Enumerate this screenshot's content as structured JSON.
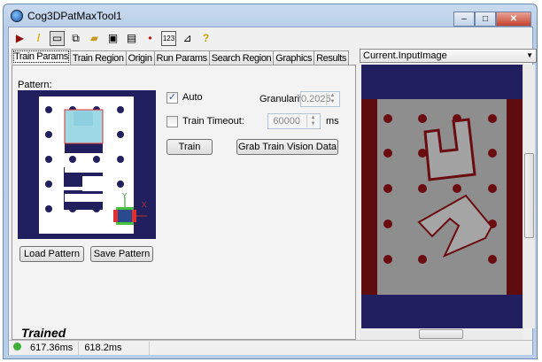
{
  "window": {
    "title": "Cog3DPatMaxTool1",
    "minimize": "–",
    "maximize": "□",
    "close": "✕"
  },
  "toolbar": {
    "icons": [
      "run-icon",
      "electric-icon",
      "show-image-icon",
      "copy-icon",
      "open-icon",
      "save-icon",
      "save-as-icon",
      "reset-icon",
      "display-icon",
      "measure-icon",
      "help-icon"
    ]
  },
  "tabs": [
    {
      "label": "Train Params"
    },
    {
      "label": "Train Region"
    },
    {
      "label": "Origin"
    },
    {
      "label": "Run Params"
    },
    {
      "label": "Search Region"
    },
    {
      "label": "Graphics"
    },
    {
      "label": "Results"
    }
  ],
  "train": {
    "pattern_label": "Pattern:",
    "auto_label": "Auto",
    "auto_checked": true,
    "granularity_label": "Granularity:",
    "granularity_value": "0.2025",
    "timeout_label": "Train Timeout:",
    "timeout_checked": false,
    "timeout_value": "60000",
    "timeout_unit": "ms",
    "train_button": "Train",
    "grab_button": "Grab Train Vision Data",
    "load_button": "Load Pattern",
    "save_button": "Save Pattern",
    "state": "Trained",
    "axis_x": "X",
    "axis_y": "Y"
  },
  "display": {
    "selected_image": "Current.InputImage",
    "dropdown_arrow": "▼"
  },
  "status": {
    "time1": "617.36ms",
    "time2": "618.2ms",
    "status_color": "#3cb034"
  },
  "colors": {
    "navy": "#211f5e",
    "dark_red": "#5e0c0e",
    "gray": "#8e8e8e",
    "pattern_cyan": "#9ed8e4",
    "accent_red": "#e03030"
  }
}
